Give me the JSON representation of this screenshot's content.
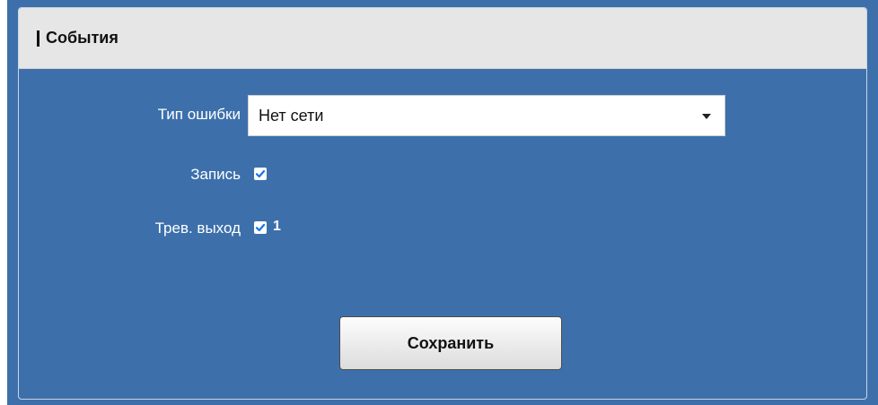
{
  "panel": {
    "title": "События"
  },
  "form": {
    "error_type": {
      "label": "Тип ошибки",
      "selected": "Нет сети"
    },
    "record": {
      "label": "Запись",
      "checked": true
    },
    "alarm_output": {
      "label": "Трев. выход",
      "checked": true,
      "channel": "1"
    },
    "save_label": "Сохранить"
  },
  "colors": {
    "panel_bg": "#3d70ab",
    "header_bg": "#e6e6e6",
    "check_color": "#1a73e8"
  },
  "icons": {
    "dropdown": "chevron-down-icon",
    "check": "check-icon"
  }
}
